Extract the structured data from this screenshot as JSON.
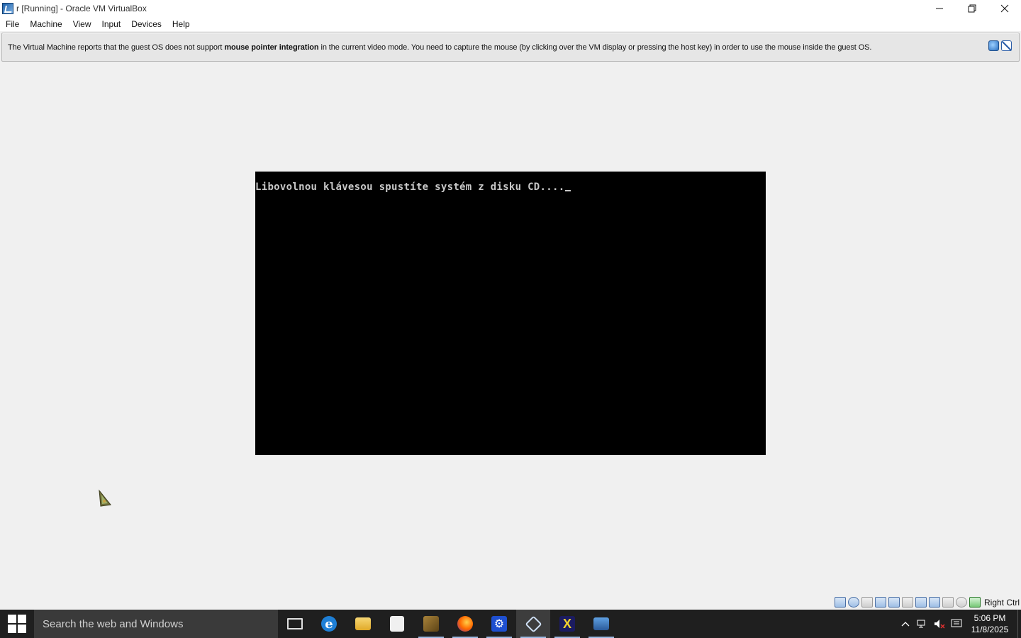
{
  "window": {
    "title": "r [Running] - Oracle VM VirtualBox",
    "icon": "virtualbox-app-icon",
    "controls": [
      "minimize",
      "restore",
      "close"
    ]
  },
  "menubar": {
    "items": [
      "File",
      "Machine",
      "View",
      "Input",
      "Devices",
      "Help"
    ]
  },
  "banner": {
    "text_before": "The Virtual Machine reports that the guest OS does not support ",
    "text_bold": "mouse pointer integration",
    "text_after": " in the current video mode. You need to capture the mouse (by clicking over the VM display or pressing the host key) in order to use the mouse inside the guest OS.",
    "icons": [
      "info-icon",
      "mouse-integration-off-icon"
    ]
  },
  "vm_display": {
    "console_text": "Libovolnou klávesou spustíte systém z disku CD....",
    "background": "#000000",
    "text_color": "#c8c8c8"
  },
  "statusbar": {
    "icons": [
      "hard-disk-icon",
      "optical-drive-icon",
      "audio-icon",
      "network-icon",
      "usb-icon",
      "shared-folders-icon",
      "display-icon",
      "video-capture-icon",
      "mouse-integration-icon",
      "keyboard-icon",
      "cpu-icon",
      "host-key-icon"
    ],
    "host_key": "Right Ctrl"
  },
  "taskbar": {
    "search_placeholder": "Search the web and Windows",
    "apps": [
      "task-view",
      "edge",
      "file-explorer",
      "store",
      "vmware",
      "firefox",
      "settings",
      "virtualbox",
      "xming",
      "remote-desktop"
    ],
    "tray": {
      "time": "5:06 PM",
      "date": "11/8/2025"
    }
  }
}
